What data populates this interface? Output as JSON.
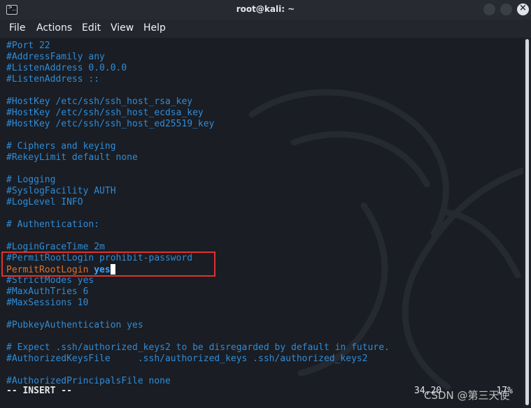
{
  "window": {
    "title": "root@kali: ~"
  },
  "menu": [
    "File",
    "Actions",
    "Edit",
    "View",
    "Help"
  ],
  "editor": {
    "lines": [
      "#Port 22",
      "#AddressFamily any",
      "#ListenAddress 0.0.0.0",
      "#ListenAddress ::",
      "",
      "#HostKey /etc/ssh/ssh_host_rsa_key",
      "#HostKey /etc/ssh/ssh_host_ecdsa_key",
      "#HostKey /etc/ssh/ssh_host_ed25519_key",
      "",
      "# Ciphers and keying",
      "#RekeyLimit default none",
      "",
      "# Logging",
      "#SyslogFacility AUTH",
      "#LogLevel INFO",
      "",
      "# Authentication:",
      "",
      "#LoginGraceTime 2m",
      "#PermitRootLogin prohibit-password",
      "",
      "#StrictModes yes",
      "#MaxAuthTries 6",
      "#MaxSessions 10",
      "",
      "#PubkeyAuthentication yes",
      "",
      "# Expect .ssh/authorized_keys2 to be disregarded by default in future.",
      "#AuthorizedKeysFile     .ssh/authorized_keys .ssh/authorized_keys2",
      "",
      "#AuthorizedPrincipalsFile none"
    ],
    "active_line": {
      "key": "PermitRootLogin ",
      "value": "yes"
    },
    "mode": "-- INSERT --",
    "cursor_pos": "34,20",
    "scroll_pos": "17%"
  },
  "overlay": {
    "credit": "CSDN @第三天使"
  },
  "colors": {
    "comment": "#2f8cd8",
    "active_key": "#e0722a",
    "value": "#3da3ff",
    "highlight_box": "#e0312f"
  }
}
